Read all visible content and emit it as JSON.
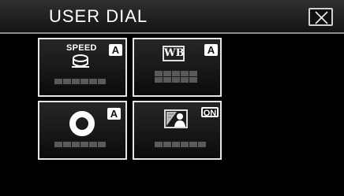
{
  "header": {
    "title": "USER DIAL"
  },
  "close_button": {
    "icon": "close-icon"
  },
  "tiles": [
    {
      "name": "speed",
      "icon_label": "SPEED",
      "badge": "A",
      "icon": "speed-dial-icon"
    },
    {
      "name": "white-balance",
      "icon_label": "WB",
      "badge": "A",
      "icon": "wb-icon"
    },
    {
      "name": "iris",
      "badge": "A",
      "icon": "iris-icon"
    },
    {
      "name": "backlight",
      "badge": "ON",
      "icon": "backlight-compensation-icon"
    }
  ],
  "colors": {
    "background": "#000000",
    "tile_border": "#e6e6e6",
    "placeholder": "#5a5a5a"
  }
}
